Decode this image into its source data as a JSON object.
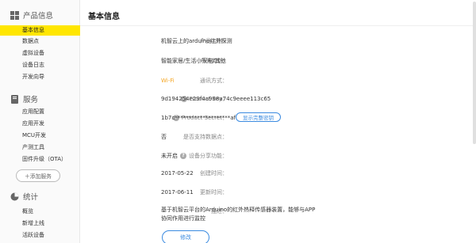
{
  "sidebar": {
    "sections": [
      {
        "title": "产品信息",
        "icon": "grid-icon"
      },
      {
        "title": "服务",
        "icon": "book-icon"
      },
      {
        "title": "统计",
        "icon": "pie-chart-icon"
      }
    ],
    "items": [
      {
        "label": "基本信息",
        "active": true
      },
      {
        "label": "数据点"
      },
      {
        "label": "虚拟设备"
      },
      {
        "label": "设备日志"
      },
      {
        "label": "开发向导"
      },
      {
        "label": "应用配置"
      },
      {
        "label": "应用开发"
      },
      {
        "label": "MCU开发"
      },
      {
        "label": "产测工具"
      },
      {
        "label": "固件升级（OTA）"
      },
      {
        "label": "概览"
      },
      {
        "label": "新增上线"
      },
      {
        "label": "活跃设备"
      }
    ],
    "add_service_label": "＋添加服务"
  },
  "main": {
    "title": "基本信息",
    "fields": [
      {
        "label": "产品名称：",
        "value": "机智云上的arduino红外探测"
      },
      {
        "label": "产品类型：",
        "value": "智能家居/生活小家电/其他"
      },
      {
        "label": "通讯方式：",
        "value": "Wi-Fi"
      },
      {
        "label": "Product Key：",
        "value": "9d194254e29f4a998a74c9eeee113c65"
      },
      {
        "label": "Product Secret：",
        "value": "1b7c********************afd9"
      },
      {
        "label": "是否支持数据点：",
        "value": "否"
      },
      {
        "label": "设备分享功能：",
        "value": "未开启"
      },
      {
        "label": "创建时间：",
        "value": "2017-05-22"
      },
      {
        "label": "更新时间：",
        "value": "2017-06-11"
      },
      {
        "label": "描述：",
        "value": "基于机智云平台的Arduino的红外热释传感器装置，能够与APP协同作用进行监控"
      }
    ],
    "show_secret_label": "显示完整密钥",
    "edit_label": "修改"
  },
  "colors": {
    "active": "#ffe600",
    "accent": "#3b8be0",
    "wifi": "#f5a623"
  }
}
